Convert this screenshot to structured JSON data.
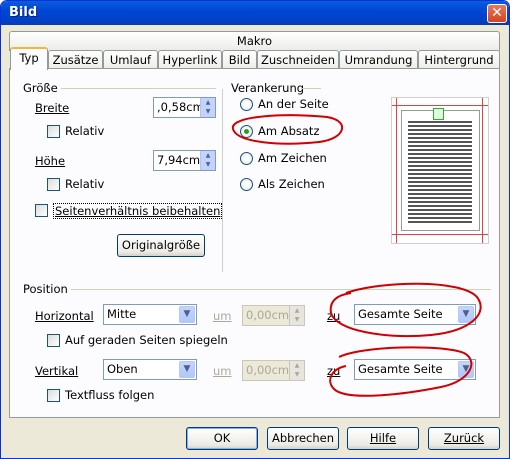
{
  "window": {
    "title": "Bild",
    "close_glyph": "✕"
  },
  "tabs_top": [
    {
      "label": "Makro"
    }
  ],
  "tabs": [
    {
      "label": "Typ"
    },
    {
      "label": "Zusätze"
    },
    {
      "label": "Umlauf"
    },
    {
      "label": "Hyperlink"
    },
    {
      "label": "Bild"
    },
    {
      "label": "Zuschneiden"
    },
    {
      "label": "Umrandung"
    },
    {
      "label": "Hintergrund"
    }
  ],
  "size": {
    "group_label": "Größe",
    "width_label": "Breite",
    "width_value": ",0,58cm",
    "width_relative": "Relativ",
    "height_label": "Höhe",
    "height_value": "7,94cm",
    "height_relative": "Relativ",
    "keep_ratio": "Seitenverhältnis beibehalten",
    "original_size_button": "Originalgröße"
  },
  "anchor": {
    "group_label": "Verankerung",
    "options": [
      {
        "label": "An der Seite",
        "selected": false
      },
      {
        "label": "Am Absatz",
        "selected": true
      },
      {
        "label": "Am Zeichen",
        "selected": false
      },
      {
        "label": "Als Zeichen",
        "selected": false
      }
    ]
  },
  "position": {
    "group_label": "Position",
    "horizontal_label": "Horizontal",
    "horizontal_value": "Mitte",
    "horizontal_by": "um",
    "horizontal_offset": "0,00cm",
    "horizontal_to": "zu",
    "horizontal_target": "Gesamte Seite",
    "mirror_label": "Auf geraden Seiten spiegeln",
    "vertical_label": "Vertikal",
    "vertical_value": "Oben",
    "vertical_by": "um",
    "vertical_offset": "0,00cm",
    "vertical_to": "zu",
    "vertical_target": "Gesamte Seite",
    "follow_text_flow": "Textfluss folgen"
  },
  "buttons": {
    "ok": "OK",
    "cancel": "Abbrechen",
    "help": "Hilfe",
    "back": "Zurück"
  },
  "colors": {
    "annotation": "#d00000",
    "titlebar": "#0046d5"
  }
}
